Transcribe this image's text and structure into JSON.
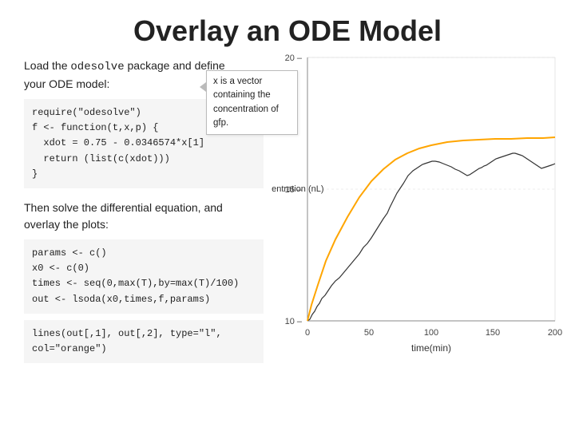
{
  "title": "Overlay an ODE Model",
  "intro_line1": "Load the ",
  "intro_code": "odesolve",
  "intro_line2": " package and define",
  "intro_line3": "your ODE model:",
  "code_block1": "require(\"odesolve\")\nf <- function(t,x,p) {\n  xdot = 0.75 - 0.0346574*x[1]\n  return (list(c(xdot)))\n}",
  "tooltip_line1": "x is a vector",
  "tooltip_line2": "containing the",
  "tooltip_line3": "concentration of",
  "tooltip_line4": "gfp.",
  "then_line1": "Then solve the differential equation, and",
  "then_line2": "overlay the plots:",
  "code_block2": "params <- c()\nx0 <- c(0)\ntimes <- seq(0,max(T),by=max(T)/100)\nout <- lsoda(x0,times,f,params)",
  "code_block3": "lines(out[,1], out[,2], type=\"l\",\ncol=\"orange\")",
  "chart": {
    "ylabel": "gfp concentration (nL)",
    "xlabel": "time(min)",
    "ymin": 10,
    "ymax": 20,
    "xmin": 0,
    "xmax": 200,
    "yticks": [
      10,
      15,
      20
    ],
    "xticks": [
      0,
      50,
      100,
      150,
      200
    ]
  }
}
